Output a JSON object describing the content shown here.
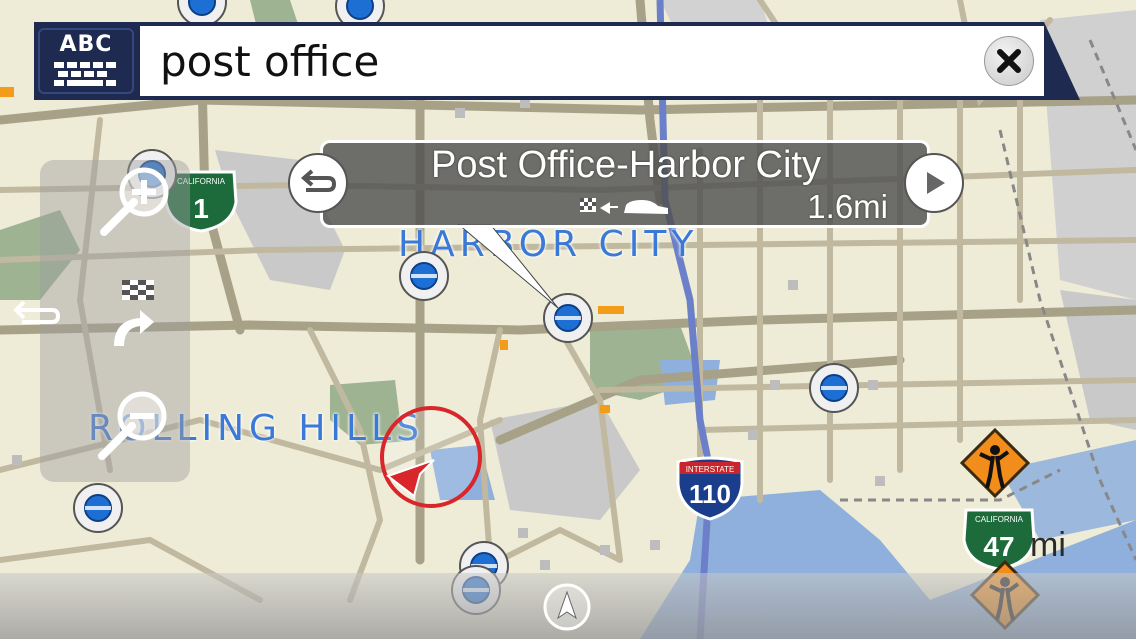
{
  "search": {
    "keyboard_label": "ABC",
    "query": "post office"
  },
  "popup": {
    "title": "Post Office-Harbor City",
    "distance": "1.6mi"
  },
  "map": {
    "place_labels": [
      "HARBOR CITY",
      "ROLLING HILLS"
    ],
    "highway_shields": [
      {
        "type": "california",
        "state_text": "CALIFORNIA",
        "number": "1"
      },
      {
        "type": "interstate",
        "state_text": "INTERSTATE",
        "number": "110"
      },
      {
        "type": "california",
        "state_text": "CALIFORNIA",
        "number": "47"
      }
    ],
    "edge_distance": "mi",
    "colors": {
      "land": "#eeebd6",
      "road": "#b9b39c",
      "water": "#8fb0dc",
      "park": "#8ea986",
      "urban": "#c6c6c6",
      "poi_blue": "#1e6fd4",
      "position_ring": "#d8262b"
    }
  },
  "icons": {
    "keyboard": "keyboard-icon",
    "clear": "close-icon",
    "back": "return-icon",
    "forward": "play-icon",
    "zoom_in": "zoom-in-icon",
    "zoom_out": "zoom-out-icon",
    "route": "checkered-flag-route-icon",
    "compass": "compass-north-icon"
  }
}
